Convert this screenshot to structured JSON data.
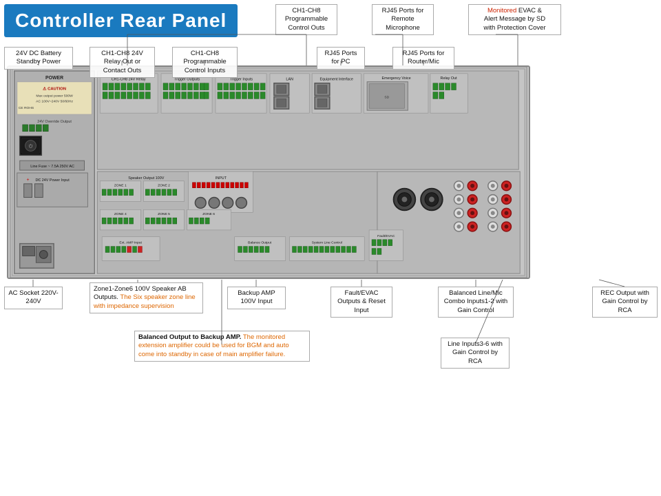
{
  "title": "Controller Rear Panel",
  "labels": {
    "top_left_title": "Controller Rear Panel",
    "annotation_ch1_ch8_prog_outs": "CH1-CH8\nProgrammable\nControl Outs",
    "annotation_rj45_remote_mic": "RJ45 Ports\nfor Remote\nMicrophone",
    "annotation_monitored_evac": "Monitored EVAC &\nAlert Message by SD\nwith Protection Cover",
    "annotation_24v_battery": "24V DC Battery\nStandby Power",
    "annotation_ch1_ch8_relay": "CH1-CH8 24V\nRelay Out or\nContact Outs",
    "annotation_ch1_ch8_inputs": "CH1-CH8\nProgrammable\nControl Inputs",
    "annotation_rj45_pc": "RJ45 Ports\nfor PC",
    "annotation_rj45_router": "RJ45 Ports for\nRouter/Mic",
    "annotation_ac_socket": "AC Socket\n220V-240V",
    "annotation_zone1_6": "Zone1-Zone6 100V Speaker\nAB Outputs.",
    "annotation_zone1_6_detail": "The Six speaker\nzone line with impedance\nsupervision",
    "annotation_backup_amp": "Backup AMP\n100V Input",
    "annotation_fault_evac": "Fault/EVAC\nOutputs &\nReset Input",
    "annotation_balanced": "Balanced\nLine/Mic Combo\nInputs1-2 with\nGain Control",
    "annotation_rec": "REC Output\nwith Gain\nControl by RCA",
    "annotation_balanced_output": "Balanced Output to Backup AMP.",
    "annotation_balanced_output_detail": "The monitored extension amplifier could be\nused for BGM and auto come into\nstandby in case of main amplifier\nfailure.",
    "annotation_line_inputs": "Line Inputs3-6\nwith Gain\nControl by\nRCA",
    "monitored_label": "Monitored"
  },
  "colors": {
    "title_bg": "#1a7abf",
    "title_text": "#ffffff",
    "monitored_red": "#cc2200",
    "orange_text": "#dd6600",
    "panel_bg": "#c5c5c5",
    "annotation_box_border": "#aaaaaa"
  }
}
